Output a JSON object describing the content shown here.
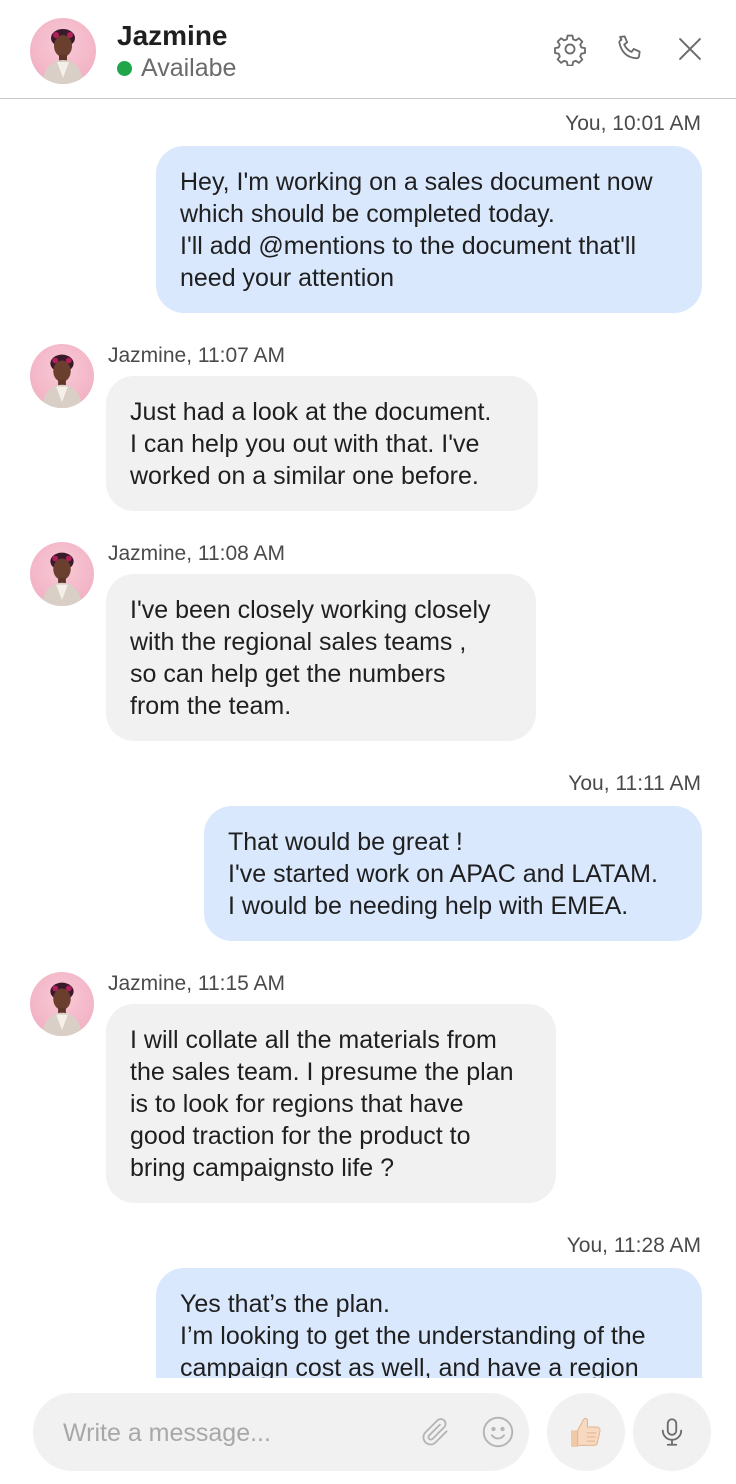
{
  "header": {
    "name": "Jazmine",
    "status": "Availabe",
    "status_color": "#1fa64a",
    "icons": [
      "gear-icon",
      "phone-icon",
      "close-icon"
    ]
  },
  "messages": [
    {
      "from": "You",
      "meta": "You, 10:01 AM",
      "text": "Hey, I'm working on a sales document now\nwhich should be completed today.\nI'll add @mentions to the document that'll\nneed your attention"
    },
    {
      "from": "Jazmine",
      "meta": "Jazmine, 11:07 AM",
      "text": "Just had a look at the document.\nI can help you out with that. I've\nworked on a similar one before."
    },
    {
      "from": "Jazmine",
      "meta": "Jazmine, 11:08 AM",
      "text": "I've been closely working closely\nwith the regional sales teams ,\nso can help get the numbers\nfrom the team."
    },
    {
      "from": "You",
      "meta": "You, 11:11 AM",
      "text": "That would be great !\nI've started work on APAC and LATAM.\nI would be needing help with EMEA."
    },
    {
      "from": "Jazmine",
      "meta": "Jazmine, 11:15 AM",
      "text": "I will collate all the materials from\nthe sales team. I presume the plan\nis to look for regions that have\ngood traction for the product to\nbring campaignsto life ?"
    },
    {
      "from": "You",
      "meta": "You, 11:28 AM",
      "text": "Yes that’s the plan.\nI’m looking to get the understanding of the\ncampaign cost as well, and have a region"
    }
  ],
  "composer": {
    "placeholder": "Write a message...",
    "icons": [
      "paperclip-icon",
      "emoji-icon",
      "thumbs-up-icon",
      "microphone-icon"
    ]
  },
  "colors": {
    "outgoing_bubble": "#d9e8fd",
    "incoming_bubble": "#f1f1f1"
  }
}
